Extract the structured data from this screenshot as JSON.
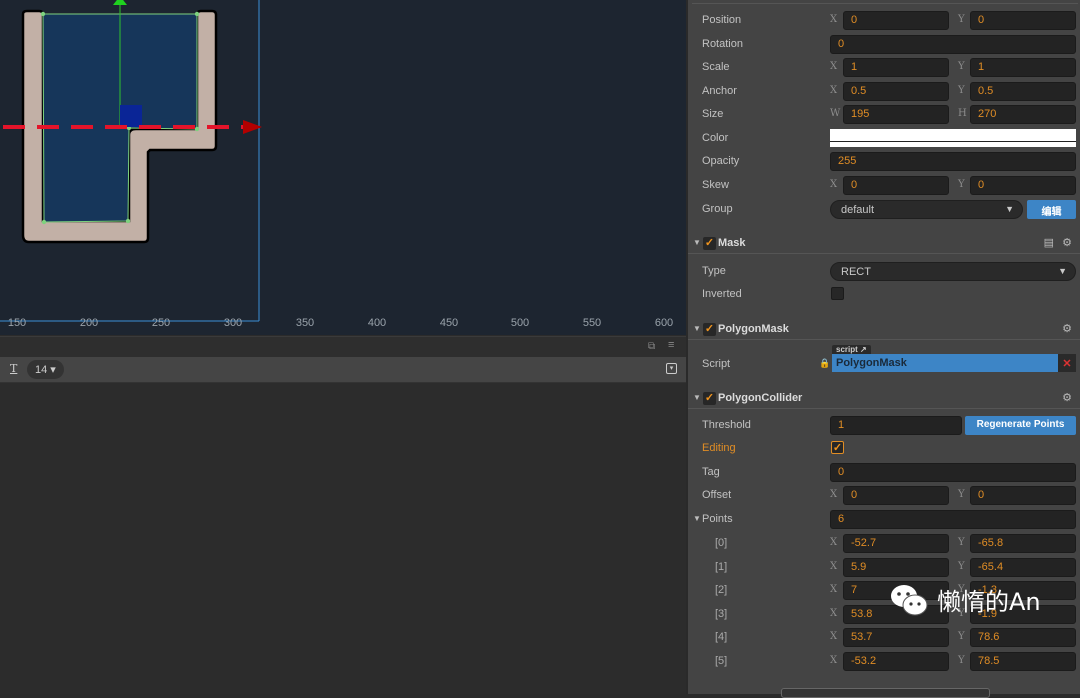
{
  "scene": {
    "ruler_labels": [
      "150",
      "200",
      "250",
      "300",
      "350",
      "400",
      "450",
      "500",
      "550",
      "600"
    ]
  },
  "toolbar": {
    "text_icon": "text-size-icon",
    "font_size": "14 ▾"
  },
  "inspector": {
    "props": [
      {
        "label": "Position",
        "x": "0",
        "y": "0"
      },
      {
        "label": "Rotation",
        "value": "0"
      },
      {
        "label": "Scale",
        "x": "1",
        "y": "1"
      },
      {
        "label": "Anchor",
        "x": "0.5",
        "y": "0.5"
      },
      {
        "label": "Size",
        "x": "195",
        "y": "270",
        "xl": "W",
        "yl": "H"
      },
      {
        "label": "Color",
        "color": "#ffffff"
      },
      {
        "label": "Opacity",
        "value": "255"
      },
      {
        "label": "Skew",
        "x": "0",
        "y": "0"
      }
    ],
    "group": {
      "label": "Group",
      "value": "default",
      "edit": "编辑"
    },
    "mask": {
      "title": "Mask",
      "type_label": "Type",
      "type_value": "RECT",
      "inverted_label": "Inverted",
      "inverted": false
    },
    "polygon_mask": {
      "title": "PolygonMask",
      "script_label": "Script",
      "script_tag": "script",
      "script_value": "PolygonMask"
    },
    "collider": {
      "title": "PolygonCollider",
      "threshold_label": "Threshold",
      "threshold": "1",
      "regen": "Regenerate Points",
      "editing_label": "Editing",
      "editing": true,
      "tag_label": "Tag",
      "tag": "0",
      "offset_label": "Offset",
      "offset_x": "0",
      "offset_y": "0",
      "points_label": "Points",
      "points_count": "6",
      "points": [
        {
          "i": "[0]",
          "x": "-52.7",
          "y": "-65.8"
        },
        {
          "i": "[1]",
          "x": "5.9",
          "y": "-65.4"
        },
        {
          "i": "[2]",
          "x": "7",
          "y": "-1.3"
        },
        {
          "i": "[3]",
          "x": "53.8",
          "y": "-1.9"
        },
        {
          "i": "[4]",
          "x": "53.7",
          "y": "78.6"
        },
        {
          "i": "[5]",
          "x": "-53.2",
          "y": "78.5"
        }
      ]
    }
  },
  "watermark": {
    "text": "懒惰的An"
  },
  "colors": {
    "accent": "#e08d25",
    "button": "#3d85c6"
  }
}
